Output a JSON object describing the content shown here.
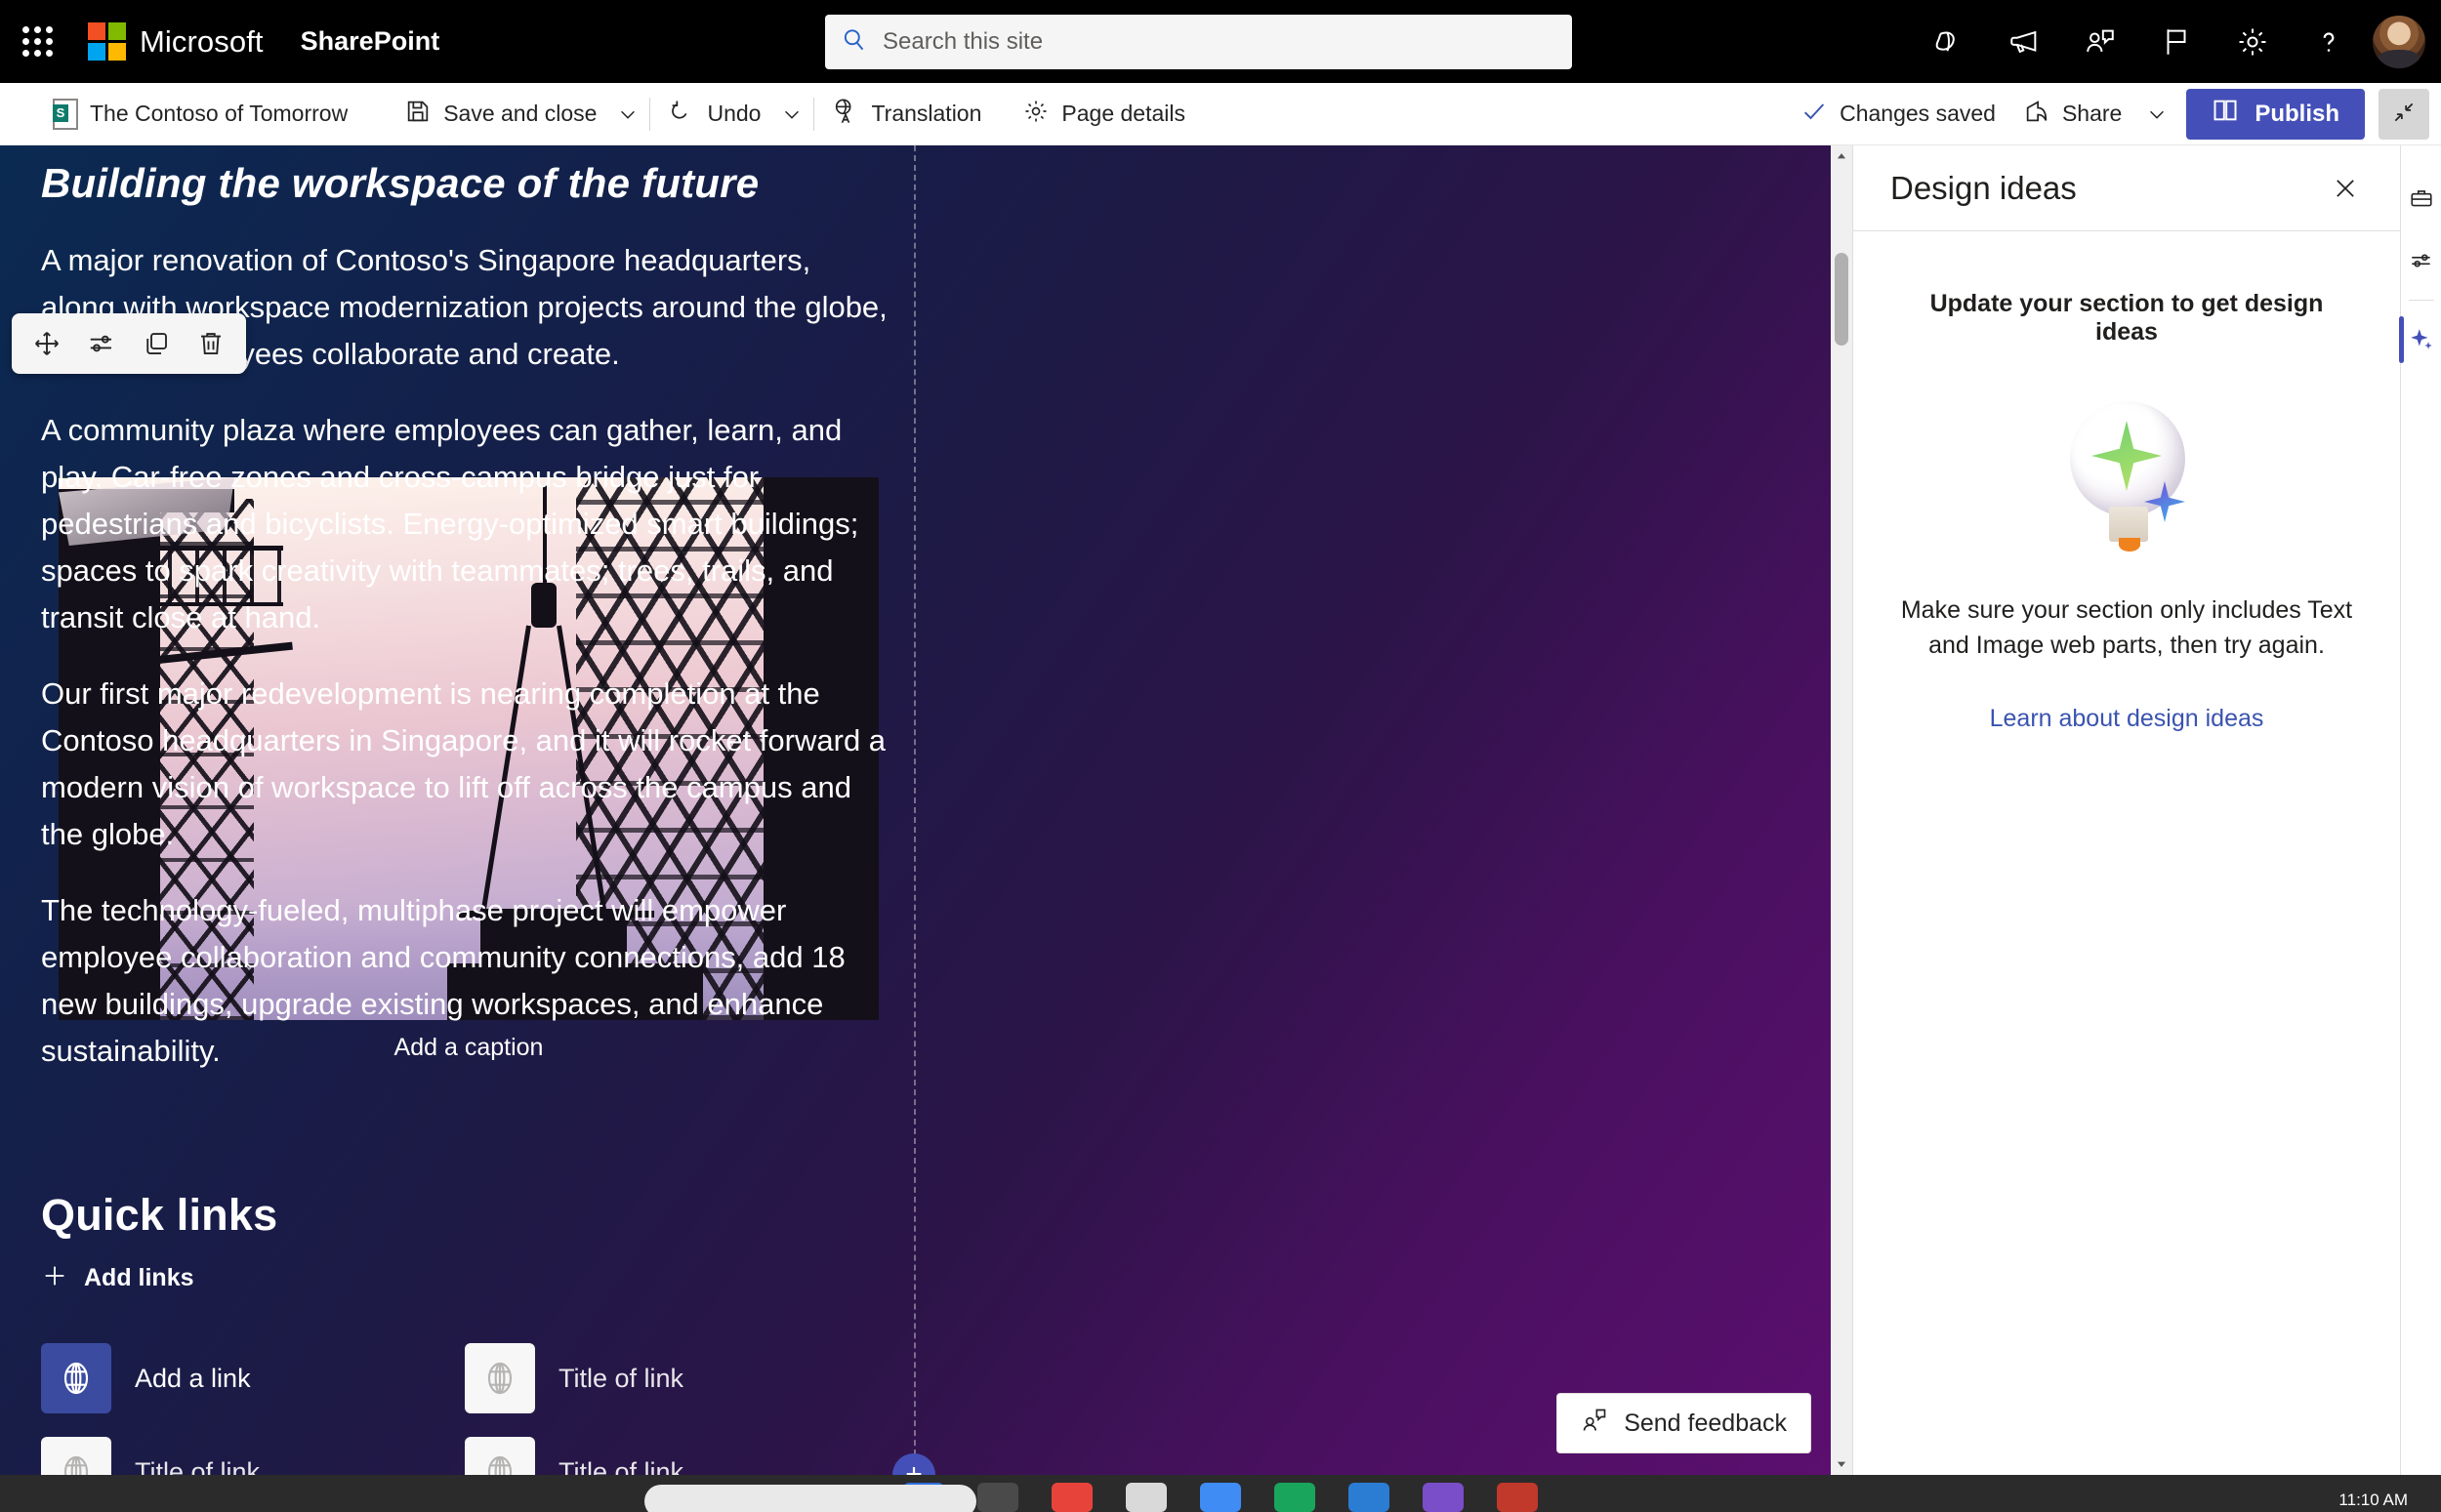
{
  "suite": {
    "waffle_label": "App launcher",
    "brand": "Microsoft",
    "app_name": "SharePoint",
    "search_placeholder": "Search this site",
    "search_value": "",
    "icons": [
      {
        "name": "copilot-icon",
        "label": "Copilot"
      },
      {
        "name": "megaphone-icon",
        "label": "What's new"
      },
      {
        "name": "feedback-icon",
        "label": "Give feedback"
      },
      {
        "name": "flag-icon",
        "label": "Report"
      },
      {
        "name": "gear-icon",
        "label": "Settings"
      },
      {
        "name": "help-icon",
        "label": "Help"
      }
    ],
    "account_label": "Account manager"
  },
  "command_bar": {
    "page_title": "The Contoso of Tomorrow",
    "save_and_close": "Save and close",
    "undo": "Undo",
    "translation": "Translation",
    "page_details": "Page details",
    "changes_saved": "Changes saved",
    "share": "Share",
    "publish": "Publish",
    "collapse_label": "Collapse ribbon"
  },
  "webpart_toolbar": [
    {
      "name": "move-handle-icon",
      "label": "Move web part"
    },
    {
      "name": "edit-properties-icon",
      "label": "Edit web part"
    },
    {
      "name": "duplicate-icon",
      "label": "Duplicate web part"
    },
    {
      "name": "trash-icon",
      "label": "Delete web part"
    }
  ],
  "canvas": {
    "image_caption": "Add a caption",
    "article": {
      "heading": "Building the workspace of the future",
      "paragraphs": [
        "A major renovation of Contoso's Singapore headquarters, along with workspace modernization projects around the globe, will help employees collaborate and create.",
        "A community plaza where employees can gather, learn, and play. Car-free zones and cross-campus bridge just for pedestrians and bicyclists. Energy-optimized smart buildings; spaces to spark creativity with teammates; trees, trails, and transit close at hand.",
        "Our first major redevelopment is nearing completion at the Contoso headquarters in Singapore, and it will rocket forward a modern vision of workspace to lift off across the campus and the globe.",
        "The technology-fueled, multiphase project will empower employee collaboration and community connections, add 18 new buildings, upgrade existing workspaces, and enhance sustainability."
      ]
    },
    "quick_links": {
      "title": "Quick links",
      "add_links": "Add links",
      "items": [
        {
          "label": "Add a link",
          "icon": "globe-icon",
          "active": true
        },
        {
          "label": "Title of link",
          "icon": "globe-icon",
          "active": false
        },
        {
          "label": "Title of link",
          "icon": "globe-icon",
          "active": false
        },
        {
          "label": "Title of link",
          "icon": "globe-icon",
          "active": false
        }
      ]
    },
    "add_section_label": "+",
    "send_feedback": "Send feedback"
  },
  "panel": {
    "title": "Design ideas",
    "close_label": "Close",
    "subtitle": "Update your section to get design ideas",
    "message": "Make sure your section only includes Text and Image web parts, then try again.",
    "link": "Learn about design ideas"
  },
  "rail": [
    {
      "name": "toolbox-icon",
      "label": "Toolbox",
      "active": false
    },
    {
      "name": "sliders-icon",
      "label": "Page settings",
      "active": false
    },
    {
      "name": "sparkle-icon",
      "label": "Design ideas",
      "active": true
    }
  ],
  "taskbar": {
    "clock": "11:10 AM"
  },
  "colors": {
    "accent": "#4450b8",
    "suite_bar": "#000000",
    "link": "#3a53b0",
    "canvas_start": "#0b2a52",
    "canvas_end": "#5c0f70"
  }
}
